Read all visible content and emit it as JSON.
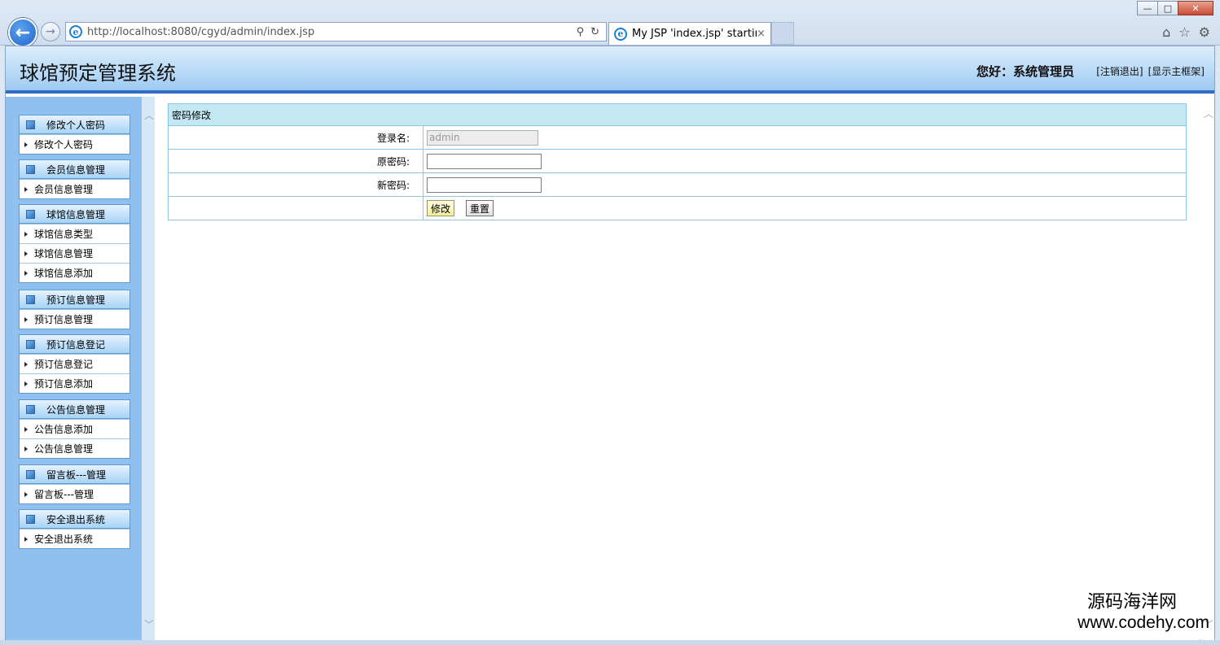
{
  "browser": {
    "url_host": "http://localhost",
    "url_rest": ":8080/cgyd/admin/index.jsp",
    "tab_title": "My JSP 'index.jsp' startin...",
    "tab_close": "×",
    "win_min": "—",
    "win_max": "□",
    "win_close": "✕",
    "back": "←",
    "forward": "→",
    "search_glyph": "⚲",
    "refresh_glyph": "↻",
    "home_glyph": "⌂",
    "star_glyph": "☆",
    "gear_glyph": "⚙"
  },
  "header": {
    "title": "球馆预定管理系统",
    "greeting": "您好：系统管理员",
    "logout": "[注销退出]",
    "show_frame": "[显示主框架]"
  },
  "sidebar": {
    "groups": [
      {
        "title": "修改个人密码",
        "items": [
          "修改个人密码"
        ]
      },
      {
        "title": "会员信息管理",
        "items": [
          "会员信息管理"
        ]
      },
      {
        "title": "球馆信息管理",
        "items": [
          "球馆信息类型",
          "球馆信息管理",
          "球馆信息添加"
        ]
      },
      {
        "title": "预订信息管理",
        "items": [
          "预订信息管理"
        ]
      },
      {
        "title": "预订信息登记",
        "items": [
          "预订信息登记",
          "预订信息添加"
        ]
      },
      {
        "title": "公告信息管理",
        "items": [
          "公告信息添加",
          "公告信息管理"
        ]
      },
      {
        "title": "留言板---管理",
        "items": [
          "留言板---管理"
        ]
      },
      {
        "title": "安全退出系统",
        "items": [
          "安全退出系统"
        ]
      }
    ]
  },
  "form": {
    "panel_title": "密码修改",
    "login_label": "登录名:",
    "login_value": "admin",
    "old_pw_label": "原密码:",
    "old_pw_value": "",
    "new_pw_label": "新密码:",
    "new_pw_value": "",
    "submit_label": "修改",
    "reset_label": "重置"
  },
  "watermark": {
    "cn": "源码海洋网",
    "url": "www.codehy.com"
  }
}
